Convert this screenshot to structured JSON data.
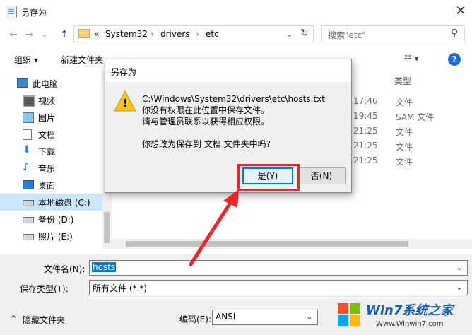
{
  "window": {
    "title": "另存为",
    "close_glyph": "✕"
  },
  "nav": {
    "back_glyph": "←",
    "forward_glyph": "→",
    "down_glyph": "⌄",
    "up_glyph": "↑",
    "address": {
      "prefix": "«",
      "parts": [
        "System32",
        "drivers",
        "etc"
      ],
      "sep": "›",
      "dropdown": "⌄",
      "refresh": "↻"
    },
    "search": {
      "placeholder": "搜索\"etc\"",
      "icon": "⚲"
    }
  },
  "toolbar": {
    "organize": "组织 ▾",
    "new_folder": "新建文件夹",
    "view": "☷ ▾",
    "help": "?"
  },
  "columns": {
    "type": "类型"
  },
  "files": [
    {
      "time": "17:46",
      "type": "文件"
    },
    {
      "time": "19:45",
      "type": "SAM 文件"
    },
    {
      "time": "21:25",
      "type": "文件"
    },
    {
      "time": "21:25",
      "type": "文件"
    },
    {
      "time": "21:25",
      "type": "文件"
    }
  ],
  "sidebar": {
    "items": [
      {
        "label": "此电脑",
        "icon": "computer-icon"
      },
      {
        "label": "视频",
        "icon": "video-icon"
      },
      {
        "label": "图片",
        "icon": "picture-icon"
      },
      {
        "label": "文档",
        "icon": "document-icon"
      },
      {
        "label": "下载",
        "icon": "download-icon"
      },
      {
        "label": "音乐",
        "icon": "music-icon"
      },
      {
        "label": "桌面",
        "icon": "desktop-icon"
      },
      {
        "label": "本地磁盘 (C:)",
        "icon": "drive-icon",
        "selected": true
      },
      {
        "label": "备份 (D:)",
        "icon": "drive-icon"
      },
      {
        "label": "照片 (E:)",
        "icon": "drive-icon"
      }
    ]
  },
  "save_form": {
    "filename_label": "文件名(N):",
    "filename_value": "hosts",
    "filetype_label": "保存类型(T):",
    "filetype_value": "所有文件  (*.*)",
    "hide_folders": "隐藏文件夹",
    "encoding_label": "编码(E):",
    "encoding_value": "ANSI",
    "dropdown": "⌄"
  },
  "dialog": {
    "title": "另存为",
    "icon_glyph": "!",
    "lines": [
      "C:\\Windows\\System32\\drivers\\etc\\hosts.txt",
      "你没有权限在此位置中保存文件。",
      "请与管理员联系以获得相应权限。",
      "",
      "你想改为保存到 文档 文件夹中吗?"
    ],
    "yes_label": "是(Y)",
    "no_label": "否(N)"
  },
  "watermark": {
    "brand": "Win7系统之家",
    "url": "Www.Winwin7.com"
  },
  "colors": {
    "accent": "#0078d7",
    "highlight": "#e8262b",
    "selection": "#cce8ff"
  }
}
